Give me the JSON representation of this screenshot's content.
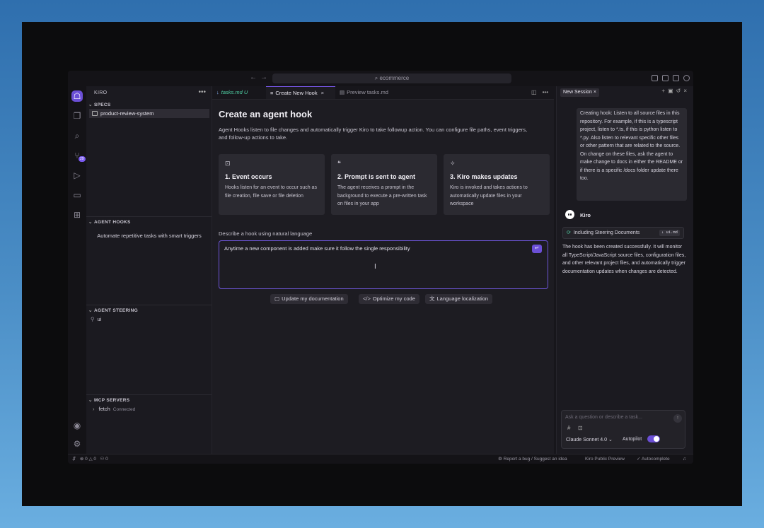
{
  "titlebar": {
    "search_text": "ecommerce",
    "back": "←",
    "forward": "→"
  },
  "activity": {
    "badge": "29"
  },
  "sidebar": {
    "header": "KIRO",
    "more": "•••",
    "specs": {
      "title": "SPECS",
      "items": [
        {
          "label": "product-review-system"
        }
      ]
    },
    "hooks": {
      "title": "AGENT HOOKS",
      "empty_text": "Automate repetitive tasks with smart triggers"
    },
    "steering": {
      "title": "AGENT STEERING",
      "items": [
        {
          "label": "ui"
        }
      ]
    },
    "mcp": {
      "title": "MCP SERVERS",
      "items": [
        {
          "label": "fetch",
          "status": "Connected"
        }
      ]
    }
  },
  "editor": {
    "tabs": [
      {
        "label": "tasks.md",
        "modified": "U"
      },
      {
        "label": "Create New Hook",
        "close": "×"
      },
      {
        "label": "Preview tasks.md"
      }
    ],
    "title": "Create an agent hook",
    "description": "Agent Hooks listen to file changes and automatically trigger Kiro to take followup action. You can configure file paths, event triggers, and follow-up actions to take.",
    "cards": [
      {
        "icon": "file-watch-icon",
        "title": "1. Event occurs",
        "text": "Hooks listen for an event to occur such as file creation, file save or file deletion"
      },
      {
        "icon": "quote-icon",
        "title": "2. Prompt is sent to agent",
        "text": "The agent receives a prompt in the background to execute a pre-written task on files in your app"
      },
      {
        "icon": "sparkle-icon",
        "title": "3. Kiro makes updates",
        "text": "Kiro is invoked and takes actions to automatically update files in your workspace"
      }
    ],
    "textarea_label": "Describe a hook using natural language",
    "textarea_value": "Anytime a new component is added make sure it follow the single responsibility",
    "suggestions": [
      {
        "icon": "doc-icon",
        "label": "Update my documentation"
      },
      {
        "icon": "code-icon",
        "label": "Optimize my code"
      },
      {
        "icon": "language-icon",
        "label": "Language localization"
      }
    ]
  },
  "chat": {
    "tab_label": "New Session",
    "tab_close": "×",
    "user_message": "Creating hook: Listen to all source files in this repository. For example, if this is a typescript project, listen to *.ts, if this is python listen to *.py. Also listen to relevant specific other files or other pattern that are related to the source. On change on these files, ask the agent to make change to docs in either the README or if there is a specific /docs folder update there too.",
    "assistant_name": "Kiro",
    "steering_label": "Including Steering Documents",
    "steering_file": "ui.md",
    "assistant_message": "The hook has been created successfully. It will monitor all TypeScript/JavaScript source files, configuration files, and other relevant project files, and automatically trigger documentation updates when changes are detected.",
    "input_placeholder": "Ask a question or describe a task...",
    "hash": "#",
    "model": "Claude Sonnet 4.0",
    "autopilot_label": "Autopilot",
    "autopilot_on": true
  },
  "statusbar": {
    "problems_errors": "0",
    "problems_warnings": "0",
    "ports": "0",
    "report": "Report a bug / Suggest an idea",
    "preview": "Kiro Public Preview",
    "autocomplete": "Autocomplete"
  }
}
